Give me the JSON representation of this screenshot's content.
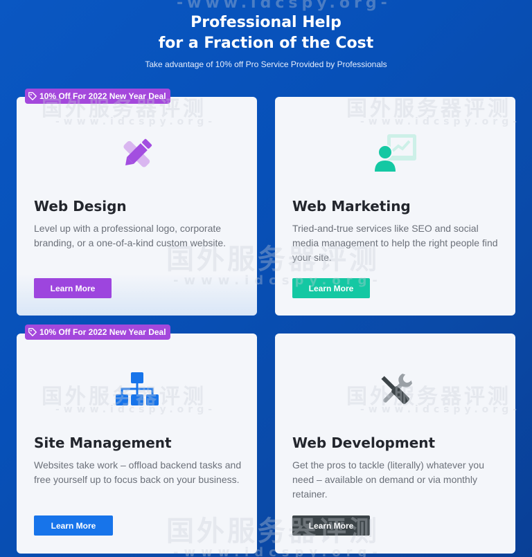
{
  "hero": {
    "title_line1": "Professional Help",
    "title_line2": "for a Fraction of the Cost",
    "subtitle": "Take advantage of 10% off Pro Service Provided by Professionals"
  },
  "badge_text": "10% Off For 2022 New Year Deal",
  "cards": [
    {
      "icon": "pencil-ruler-icon",
      "title": "Web Design",
      "description": "Level up with a professional logo, corporate branding, or a one-of-a-kind custom website.",
      "button": "Learn More",
      "accent": "#9d45de",
      "has_badge": true
    },
    {
      "icon": "person-presentation-chart-icon",
      "title": "Web Marketing",
      "description": "Tried-and-true services like SEO and social media management to help the right people find your site.",
      "button": "Learn More",
      "accent": "#14c8a3",
      "has_badge": false
    },
    {
      "icon": "sitemap-icon",
      "title": "Site Management",
      "description": "Websites take work – offload backend tasks and free yourself up to focus back on your business.",
      "button": "Learn More",
      "accent": "#1774ea",
      "has_badge": true
    },
    {
      "icon": "wrench-screwdriver-icon",
      "title": "Web Development",
      "description": "Get the pros to tackle (literally) whatever you need – available on demand or via monthly retainer.",
      "button": "Learn More",
      "accent": "#3c4448",
      "has_badge": false
    }
  ],
  "watermark": {
    "cn": "国外服务器评测",
    "url": "-www.idcspy.org-"
  }
}
